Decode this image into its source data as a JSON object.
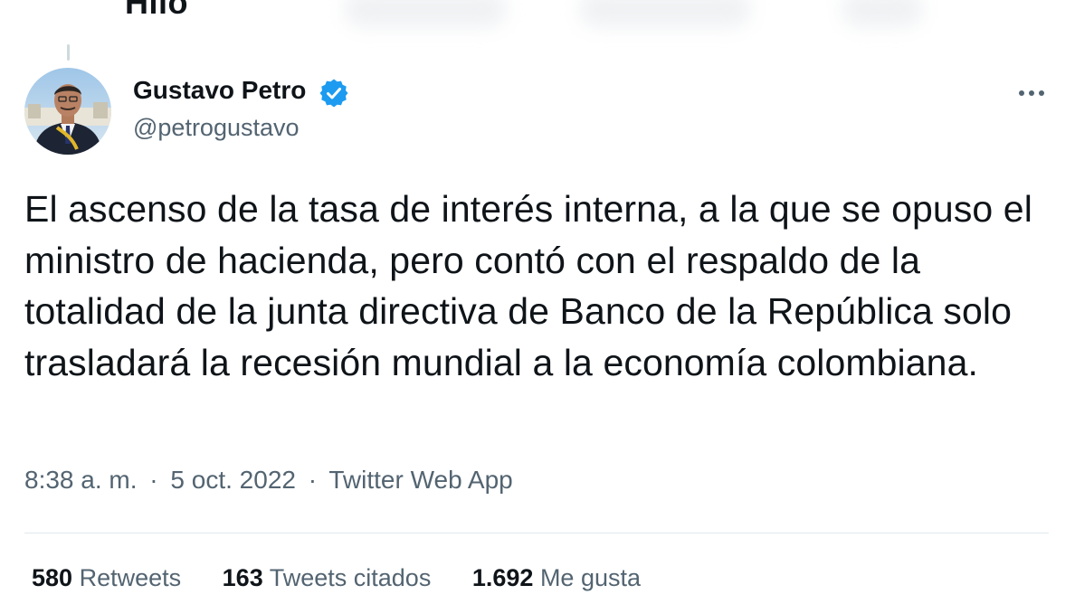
{
  "header": {
    "title": "Hilo",
    "back_icon": "back-arrow-icon"
  },
  "tweet": {
    "author": {
      "name": "Gustavo Petro",
      "handle": "@petrogustavo",
      "verified": true,
      "verified_color": "#1d9bf0"
    },
    "text": "El ascenso de la tasa de interés interna, a la que se opuso el ministro de hacienda, pero contó con el respaldo de la totalidad de la junta directiva de Banco de la República solo trasladará la recesión mundial a la economía colombiana.",
    "time": "8:38 a. m.",
    "date": "5 oct. 2022",
    "separator": "·",
    "source": "Twitter Web App"
  },
  "stats": {
    "retweets": {
      "count": "580",
      "label": "Retweets"
    },
    "quotes": {
      "count": "163",
      "label": "Tweets citados"
    },
    "likes": {
      "count": "1.692",
      "label": "Me gusta"
    }
  },
  "colors": {
    "text_primary": "#0f1419",
    "text_secondary": "#536471",
    "divider": "#e1e8ed",
    "accent": "#1d9bf0"
  }
}
